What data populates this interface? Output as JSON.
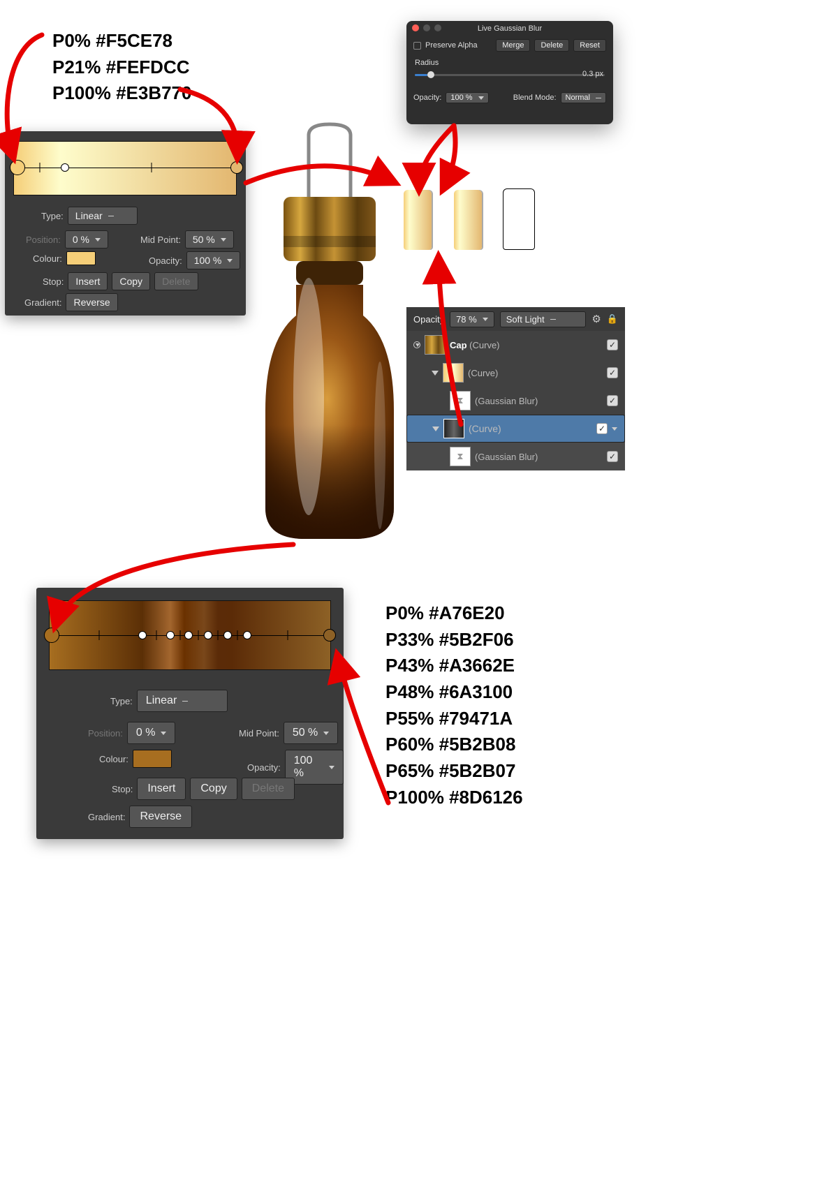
{
  "annotations": {
    "gold": {
      "line0": "P0% #F5CE78",
      "line1": "P21% #FEFDCC",
      "line2": "P100% #E3B770"
    },
    "bronze": {
      "line0": "P0% #A76E20",
      "line1": "P33% #5B2F06",
      "line2": "P43% #A3662E",
      "line3": "P48% #6A3100",
      "line4": "P55% #79471A",
      "line5": "P60% #5B2B08",
      "line6": "P65% #5B2B07",
      "line7": "P100% #8D6126"
    }
  },
  "grad_gold": {
    "panel": {
      "type_label": "Type:",
      "type_value": "Linear",
      "position_label": "Position:",
      "position_value": "0 %",
      "midpoint_label": "Mid Point:",
      "midpoint_value": "50 %",
      "colour_label": "Colour:",
      "opacity_label": "Opacity:",
      "opacity_value": "100 %",
      "stop_label": "Stop:",
      "insert": "Insert",
      "copy": "Copy",
      "delete": "Delete",
      "gradient_label": "Gradient:",
      "reverse": "Reverse"
    },
    "stops": [
      {
        "pos": 0,
        "color": "#F5CE78"
      },
      {
        "pos": 21,
        "color": "#FEFDCC"
      },
      {
        "pos": 100,
        "color": "#E3B770"
      }
    ]
  },
  "grad_bronze": {
    "panel": {
      "type_label": "Type:",
      "type_value": "Linear",
      "position_label": "Position:",
      "position_value": "0 %",
      "midpoint_label": "Mid Point:",
      "midpoint_value": "50 %",
      "colour_label": "Colour:",
      "opacity_label": "Opacity:",
      "opacity_value": "100 %",
      "stop_label": "Stop:",
      "insert": "Insert",
      "copy": "Copy",
      "delete": "Delete",
      "gradient_label": "Gradient:",
      "reverse": "Reverse"
    },
    "stops": [
      {
        "pos": 0,
        "color": "#A76E20"
      },
      {
        "pos": 33,
        "color": "#5B2F06"
      },
      {
        "pos": 43,
        "color": "#A3662E"
      },
      {
        "pos": 48,
        "color": "#6A3100"
      },
      {
        "pos": 55,
        "color": "#79471A"
      },
      {
        "pos": 60,
        "color": "#5B2B08"
      },
      {
        "pos": 65,
        "color": "#5B2B07"
      },
      {
        "pos": 100,
        "color": "#8D6126"
      }
    ]
  },
  "gauss": {
    "title": "Live Gaussian Blur",
    "preserve_alpha": "Preserve Alpha",
    "merge": "Merge",
    "delete": "Delete",
    "reset": "Reset",
    "radius_label": "Radius",
    "radius_value": "0.3 px",
    "opacity_label": "Opacity:",
    "opacity_value": "100 %",
    "blend_label": "Blend Mode:",
    "blend_value": "Normal"
  },
  "layers": {
    "opacity_label": "Opacity",
    "opacity_value": "78 %",
    "blend_value": "Soft Light",
    "rows": {
      "r0": {
        "name_bold": "Cap",
        "name_rest": " (Curve)"
      },
      "r1": {
        "name": "(Curve)"
      },
      "r2": {
        "name": "(Gaussian Blur)"
      },
      "r3": {
        "name": "(Curve)"
      },
      "r4": {
        "name": "(Gaussian Blur)"
      }
    }
  }
}
